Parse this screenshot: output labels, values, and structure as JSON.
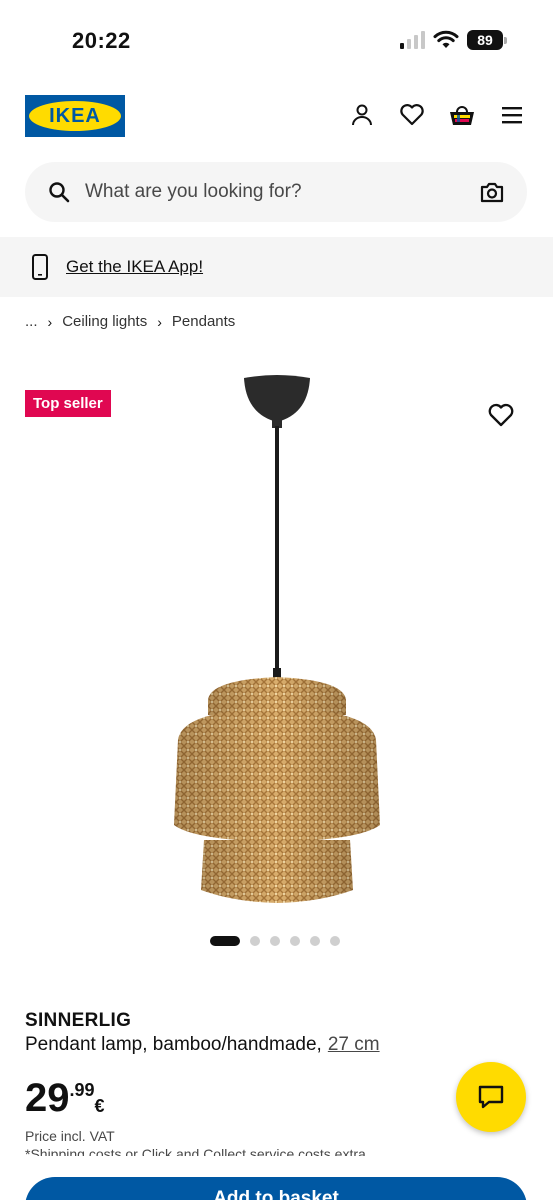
{
  "status_bar": {
    "time": "20:22",
    "battery": "89"
  },
  "header": {
    "logo_text": "IKEA"
  },
  "search": {
    "placeholder": "What are you looking for?"
  },
  "app_banner": {
    "link_label": "Get the IKEA App!"
  },
  "breadcrumb": {
    "ellipsis": "...",
    "items": [
      "Ceiling lights",
      "Pendants"
    ]
  },
  "product": {
    "badge": "Top seller",
    "name": "SINNERLIG",
    "description": "Pendant lamp, bamboo/handmade,",
    "size": "27 cm",
    "price_integer": "29",
    "price_decimal": ".99",
    "currency": "€",
    "vat_note": "Price incl. VAT",
    "shipping_note": "*Shipping costs or Click and Collect service costs extra",
    "image_count": 6,
    "active_image": 1
  },
  "actions": {
    "add_to_basket": "Add to basket"
  },
  "colors": {
    "ikea_blue": "#0058a3",
    "ikea_yellow": "#ffdb00",
    "badge_red": "#e00751"
  }
}
